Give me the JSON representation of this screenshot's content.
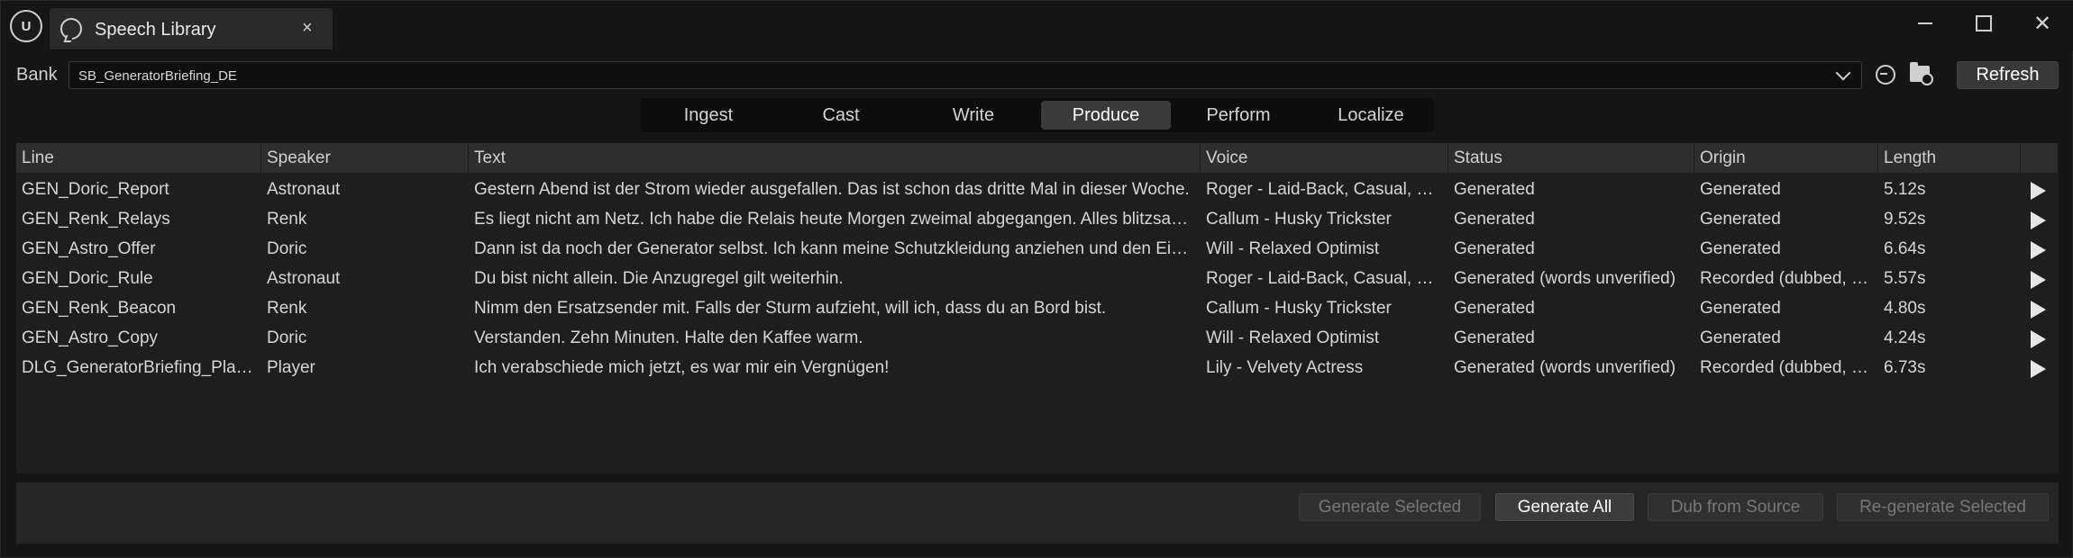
{
  "window": {
    "logo_text": "U"
  },
  "tab": {
    "title": "Speech Library",
    "close_glyph": "×"
  },
  "window_controls": {
    "close_glyph": "✕"
  },
  "bank": {
    "label": "Bank",
    "value": "SB_GeneratorBriefing_DE"
  },
  "refresh_label": "Refresh",
  "mode_tabs": [
    "Ingest",
    "Cast",
    "Write",
    "Produce",
    "Perform",
    "Localize"
  ],
  "active_mode": "Produce",
  "table": {
    "columns": [
      "Line",
      "Speaker",
      "Text",
      "Voice",
      "Status",
      "Origin",
      "Length"
    ],
    "rows": [
      [
        "GEN_Doric_Report",
        "Astronaut",
        "Gestern Abend ist der Strom wieder ausgefallen. Das ist schon das dritte Mal in dieser Woche.",
        "Roger - Laid-Back, Casual, Resonant",
        "Generated",
        "Generated",
        "5.12s"
      ],
      [
        "GEN_Renk_Relays",
        "Renk",
        "Es liegt nicht am Netz. Ich habe die Relais heute Morgen zweimal abgegangen. Alles blitzsauber.",
        "Callum - Husky Trickster",
        "Generated",
        "Generated",
        "9.52s"
      ],
      [
        "GEN_Astro_Offer",
        "Doric",
        "Dann ist da noch der Generator selbst. Ich kann meine Schutzkleidung anziehen und den Eingang prüfen.",
        "Will - Relaxed Optimist",
        "Generated",
        "Generated",
        "6.64s"
      ],
      [
        "GEN_Doric_Rule",
        "Astronaut",
        "Du bist nicht allein. Die Anzugregel gilt weiterhin.",
        "Roger - Laid-Back, Casual, Resonant",
        "Generated  (words unverified)",
        "Recorded (dubbed, reviewed)",
        "5.57s"
      ],
      [
        "GEN_Renk_Beacon",
        "Renk",
        "Nimm den Ersatzsender mit. Falls der Sturm aufzieht, will ich, dass du an Bord bist.",
        "Callum - Husky Trickster",
        "Generated",
        "Generated",
        "4.80s"
      ],
      [
        "GEN_Astro_Copy",
        "Doric",
        "Verstanden. Zehn Minuten. Halte den Kaffee warm.",
        "Will - Relaxed Optimist",
        "Generated",
        "Generated",
        "4.24s"
      ],
      [
        "DLG_GeneratorBriefing_Player",
        "Player",
        "Ich verabschiede mich jetzt, es war mir ein Vergnügen!",
        "Lily - Velvety Actress",
        "Generated  (words unverified)",
        "Recorded (dubbed, reviewed)",
        "6.73s"
      ]
    ]
  },
  "actions": {
    "generate_selected": "Generate Selected",
    "generate_all": "Generate All",
    "dub_from_source": "Dub from Source",
    "regenerate_selected": "Re-generate Selected"
  }
}
